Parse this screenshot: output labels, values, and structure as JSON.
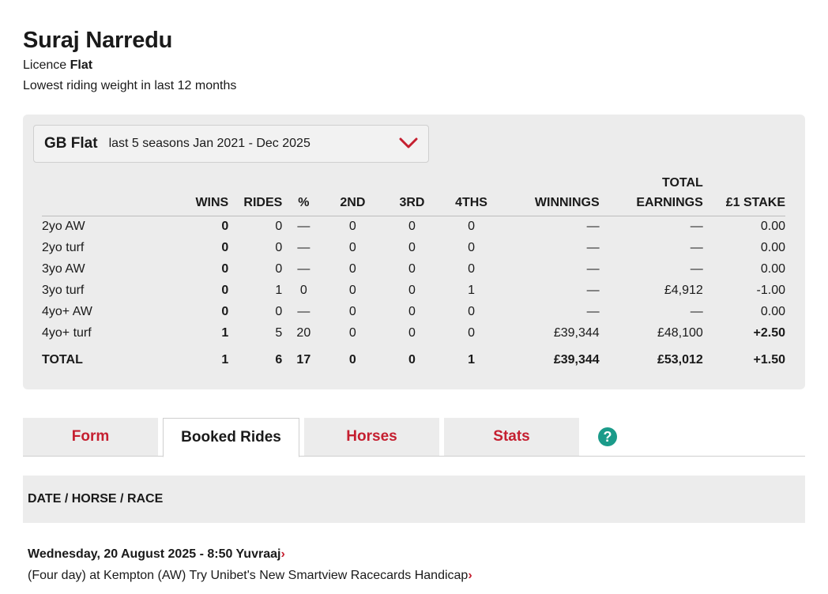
{
  "jockey": {
    "name": "Suraj Narredu",
    "licence_label": "Licence",
    "licence_value": "Flat",
    "lowest_weight_label": "Lowest riding weight in last 12 months"
  },
  "selector": {
    "main": "GB Flat",
    "sub": "last 5 seasons Jan 2021 - Dec 2025",
    "icon": "chevron-down-icon",
    "icon_color": "#c51f30"
  },
  "table": {
    "headers": {
      "wins": "WINS",
      "rides": "RIDES",
      "pct": "%",
      "second": "2ND",
      "third": "3RD",
      "fourth": "4THS",
      "winnings": "WINNINGS",
      "total_earnings_1": "TOTAL",
      "total_earnings_2": "EARNINGS",
      "stake": "£1 STAKE"
    },
    "rows": [
      {
        "label": "2yo AW",
        "wins": "0",
        "rides": "0",
        "pct": "—",
        "second": "0",
        "third": "0",
        "fourth": "0",
        "winnings": "—",
        "earnings": "—",
        "stake": "0.00"
      },
      {
        "label": "2yo turf",
        "wins": "0",
        "rides": "0",
        "pct": "—",
        "second": "0",
        "third": "0",
        "fourth": "0",
        "winnings": "—",
        "earnings": "—",
        "stake": "0.00"
      },
      {
        "label": "3yo AW",
        "wins": "0",
        "rides": "0",
        "pct": "—",
        "second": "0",
        "third": "0",
        "fourth": "0",
        "winnings": "—",
        "earnings": "—",
        "stake": "0.00"
      },
      {
        "label": "3yo turf",
        "wins": "0",
        "rides": "1",
        "pct": "0",
        "second": "0",
        "third": "0",
        "fourth": "1",
        "winnings": "—",
        "earnings": "£4,912",
        "stake": "-1.00"
      },
      {
        "label": "4yo+ AW",
        "wins": "0",
        "rides": "0",
        "pct": "—",
        "second": "0",
        "third": "0",
        "fourth": "0",
        "winnings": "—",
        "earnings": "—",
        "stake": "0.00"
      },
      {
        "label": "4yo+ turf",
        "wins": "1",
        "rides": "5",
        "pct": "20",
        "second": "0",
        "third": "0",
        "fourth": "0",
        "winnings": "£39,344",
        "earnings": "£48,100",
        "stake": "+2.50"
      }
    ],
    "total": {
      "label": "TOTAL",
      "wins": "1",
      "rides": "6",
      "pct": "17",
      "second": "0",
      "third": "0",
      "fourth": "1",
      "winnings": "£39,344",
      "earnings": "£53,012",
      "stake": "+1.50"
    }
  },
  "tabs": {
    "form": "Form",
    "booked": "Booked Rides",
    "horses": "Horses",
    "stats": "Stats",
    "help_icon": "?",
    "accent": "#c51f30",
    "help_color": "#1b9b8a"
  },
  "list": {
    "header": "DATE / HORSE / RACE",
    "ride": {
      "line1": "Wednesday, 20 August 2025 - 8:50 Yuvraaj",
      "line2": "(Four day) at Kempton (AW) Try Unibet's New Smartview Racecards Handicap",
      "arrow": "›"
    }
  }
}
